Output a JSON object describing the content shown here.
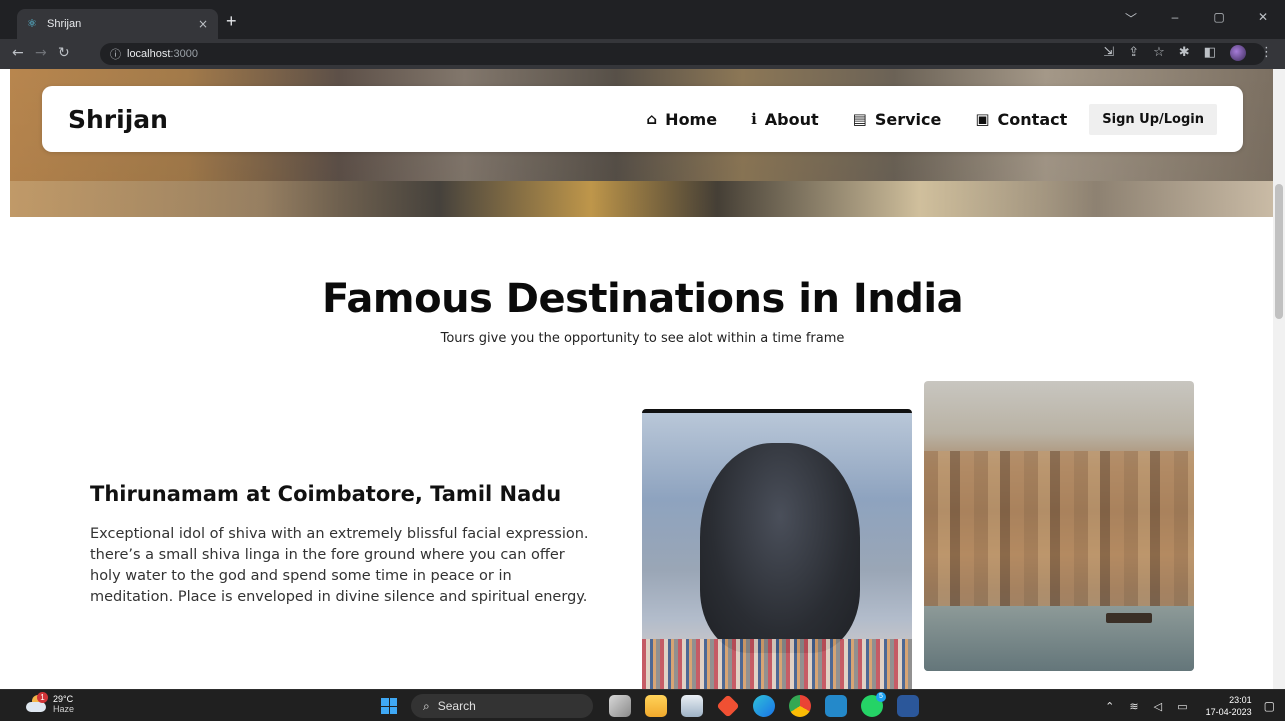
{
  "browser": {
    "tab_title": "Shrijan",
    "tab_close": "×",
    "new_tab": "+",
    "url_host": "localhost",
    "url_port": ":3000",
    "window_controls": [
      "﹀",
      "–",
      "▢",
      "✕"
    ]
  },
  "navbar": {
    "brand": "Shrijan",
    "links": [
      {
        "label": "Home",
        "icon": "home-icon"
      },
      {
        "label": "About",
        "icon": "info-icon"
      },
      {
        "label": "Service",
        "icon": "briefcase-icon"
      },
      {
        "label": "Contact",
        "icon": "contact-card-icon"
      }
    ],
    "signup_label": "Sign Up/Login"
  },
  "section": {
    "heading": "Famous Destinations in India",
    "subheading": "Tours give you the opportunity to see alot within a time frame"
  },
  "destination": {
    "title": "Thirunamam at Coimbatore, Tamil Nadu",
    "description": "Exceptional idol of shiva with an extremely blissful facial expression. there’s a small shiva linga in the fore ground where you can offer holy water to the god and spend some time in peace or in meditation. Place is enveloped in divine silence and spiritual energy."
  },
  "taskbar": {
    "weather_temp": "29°C",
    "weather_cond": "Haze",
    "weather_badge": "1",
    "search_label": "Search",
    "whatsapp_badge": "5",
    "time": "23:01",
    "date": "17-04-2023"
  },
  "colors": {
    "accent": "#111111",
    "signup_bg": "#efefef",
    "chrome_dark": "#202124",
    "chrome_toolbar": "#35363a",
    "taskbar_bg": "#202020"
  }
}
